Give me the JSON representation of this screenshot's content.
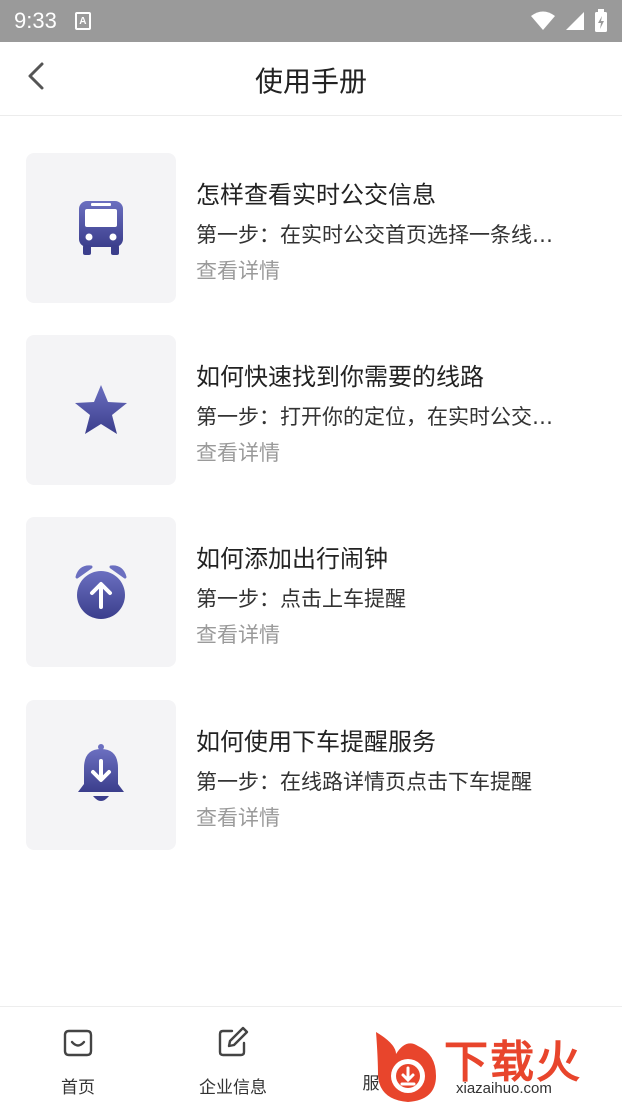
{
  "status_bar": {
    "time": "9:33",
    "badge": "A"
  },
  "header": {
    "title": "使用手册"
  },
  "items": [
    {
      "icon": "bus-icon",
      "title": "怎样查看实时公交信息",
      "desc": "第一步：在实时公交首页选择一条线…",
      "link": "查看详情"
    },
    {
      "icon": "star-icon",
      "title": "如何快速找到你需要的线路",
      "desc": "第一步：打开你的定位，在实时公交…",
      "link": "查看详情"
    },
    {
      "icon": "alarm-clock-icon",
      "title": "如何添加出行闹钟",
      "desc": "第一步：点击上车提醒",
      "link": "查看详情"
    },
    {
      "icon": "bell-icon",
      "title": "如何使用下车提醒服务",
      "desc": "第一步：在线路详情页点击下车提醒",
      "link": "查看详情"
    }
  ],
  "bottom_nav": [
    {
      "label": "首页",
      "icon": "home-bag-icon"
    },
    {
      "label": "企业信息",
      "icon": "edit-icon"
    },
    {
      "label": "服",
      "icon": "service-icon"
    }
  ],
  "watermark": {
    "brand": "下载火",
    "url": "xiazaihuo.com"
  },
  "colors": {
    "accent": "#4a4d9c",
    "accent_light": "#6b6fc0",
    "watermark": "#e8452c"
  }
}
